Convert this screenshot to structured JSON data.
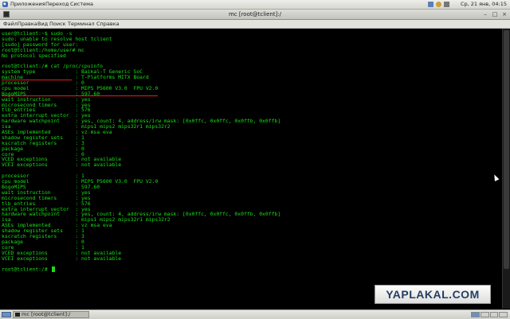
{
  "top_panel": {
    "menu": [
      "Приложения",
      "Переход",
      "Система"
    ],
    "clock": "Ср, 21 янв, 04:15"
  },
  "window": {
    "title": "mc [root@tclient]:/",
    "menubar": [
      "Файл",
      "Правка",
      "Вид",
      "Поиск",
      "Терминал",
      "Справка"
    ]
  },
  "terminal": {
    "lines": [
      "user@tclient:~$ sudo -s",
      "sudo: unable to resolve host tclient",
      "[sudo] password for user:",
      "root@tclient:/home/user# mc",
      "No protocol specified",
      "",
      "root@tclient:/# cat /proc/cpuinfo",
      "system type             : Baikal-T Generic SoC",
      "machine                 : T-Platforms MITX Board",
      "processor               : 0",
      "cpu model               : MIPS P5600 V3.0  FPU V2.0",
      "BogoMIPS                : 597.60",
      "wait instruction        : yes",
      "microsecond timers      : yes",
      "tlb_entries             : 576",
      "extra interrupt vector  : yes",
      "hardware watchpoint     : yes, count: 4, address/irw mask: [0x0ffc, 0x0ffc, 0x0ffb, 0x0ffb]",
      "isa                     : mips1 mips2 mips32r1 mips32r2",
      "ASEs implemented        : vz msa eva",
      "shadow register sets    : 1",
      "kscratch registers      : 3",
      "package                 : 0",
      "core                    : 0",
      "VCED exceptions         : not available",
      "VCEI exceptions         : not available",
      "",
      "processor               : 1",
      "cpu model               : MIPS P5600 V3.0  FPU V2.0",
      "BogoMIPS                : 597.60",
      "wait instruction        : yes",
      "microsecond timers      : yes",
      "tlb_entries             : 576",
      "extra interrupt vector  : yes",
      "hardware watchpoint     : yes, count: 4, address/irw mask: [0x0ffc, 0x0ffc, 0x0ffb, 0x0ffb]",
      "isa                     : mips1 mips2 mips32r1 mips32r2",
      "ASEs implemented        : vz msa eva",
      "shadow register sets    : 1",
      "kscratch registers      : 3",
      "package                 : 0",
      "core                    : 1",
      "VCED exceptions         : not available",
      "VCEI exceptions         : not available",
      "",
      "root@tclient:/# "
    ],
    "colors": {
      "foreground": "#16e016",
      "background": "#000000",
      "highlight": "#e02020"
    }
  },
  "watermark": "YAPLAKAL.COM",
  "taskbar": {
    "task_label": "mc [root@tclient]:/"
  },
  "icons": {
    "apps": "applications-icon",
    "terminal": "terminal-icon",
    "close": "close-icon",
    "minimize": "minimize-icon",
    "maximize": "maximize-icon"
  }
}
